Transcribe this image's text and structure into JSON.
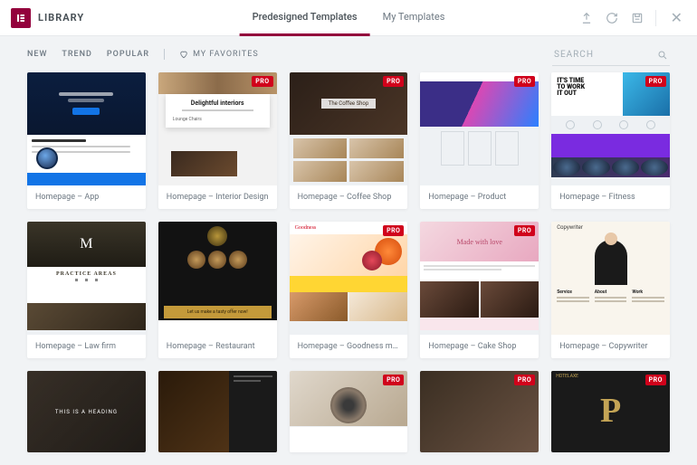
{
  "header": {
    "title": "LIBRARY",
    "tabs": [
      {
        "label": "Predesigned Templates",
        "active": true
      },
      {
        "label": "My Templates",
        "active": false
      }
    ]
  },
  "toolbar": {
    "filters": [
      "NEW",
      "TREND",
      "POPULAR"
    ],
    "favorites_label": "MY FAVORITES",
    "search_placeholder": "SEARCH"
  },
  "pro_badge": "PRO",
  "templates": [
    {
      "title": "Homepage – App",
      "pro": false
    },
    {
      "title": "Homepage – Interior Design",
      "pro": true
    },
    {
      "title": "Homepage – Coffee Shop",
      "pro": true
    },
    {
      "title": "Homepage – Product",
      "pro": true
    },
    {
      "title": "Homepage – Fitness",
      "pro": true
    },
    {
      "title": "Homepage – Law firm",
      "pro": false
    },
    {
      "title": "Homepage – Restaurant",
      "pro": false
    },
    {
      "title": "Homepage – Goodness meal servi...",
      "pro": true
    },
    {
      "title": "Homepage – Cake Shop",
      "pro": true
    },
    {
      "title": "Homepage – Copywriter",
      "pro": false
    }
  ],
  "row3_pro": [
    false,
    false,
    true,
    true,
    true
  ],
  "thumb_text": {
    "interior_heading": "Delightful interiors",
    "interior_sub": "Lounge Chairs",
    "coffee_label": "The Coffee Shop",
    "fitness_line1": "IT'S TIME",
    "fitness_line2": "TO WORK",
    "fitness_line3": "IT OUT",
    "law_heading": "PRACTICE AREAS",
    "rest_cta": "Let us make a tasty offer now!",
    "good_brand": "Goodness",
    "cake_script": "Made with love",
    "copy_brand": "Copywriter",
    "r1_heading": "THIS IS A HEADING",
    "r5_brand": "HOTELAXE"
  }
}
